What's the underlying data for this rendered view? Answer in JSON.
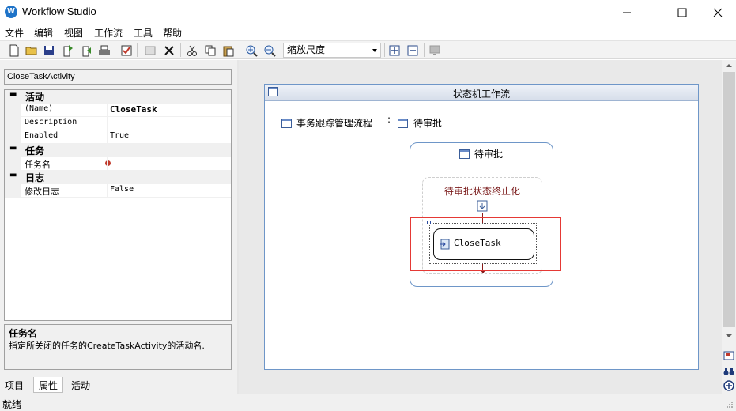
{
  "window": {
    "title": "Workflow Studio",
    "icon_letter": "W"
  },
  "menu": [
    "文件",
    "编辑",
    "视图",
    "工作流",
    "工具",
    "帮助"
  ],
  "toolbar": {
    "zoom_label": "缩放尺度"
  },
  "properties": {
    "activity_name": "CloseTaskActivity",
    "categories": [
      {
        "label": "活动",
        "rows": [
          {
            "key": "(Name)",
            "value": "CloseTask"
          },
          {
            "key": "Description",
            "value": ""
          },
          {
            "key": "Enabled",
            "value": "True"
          }
        ]
      },
      {
        "label": "任务",
        "rows": [
          {
            "key": "任务名",
            "value": ""
          }
        ]
      },
      {
        "label": "日志",
        "rows": [
          {
            "key": "修改日志",
            "value": "False"
          }
        ]
      }
    ],
    "description_title": "任务名",
    "description_text": "指定所关闭的任务的CreateTaskActivity的活动名.",
    "tabs": [
      "项目",
      "属性",
      "活动"
    ]
  },
  "designer": {
    "workflow_title": "状态机工作流",
    "breadcrumb": [
      "事务跟踪管理流程",
      "待审批"
    ],
    "breadcrumb_sep": ":",
    "state_title": "待审批",
    "finalization_label": "待审批状态终止化",
    "activity_label": "CloseTask",
    "colors": {
      "highlight": "#e53935",
      "frame_border": "#6e96c8",
      "finalization_text": "#7a1a1a"
    }
  },
  "status": {
    "text": "就绪"
  }
}
